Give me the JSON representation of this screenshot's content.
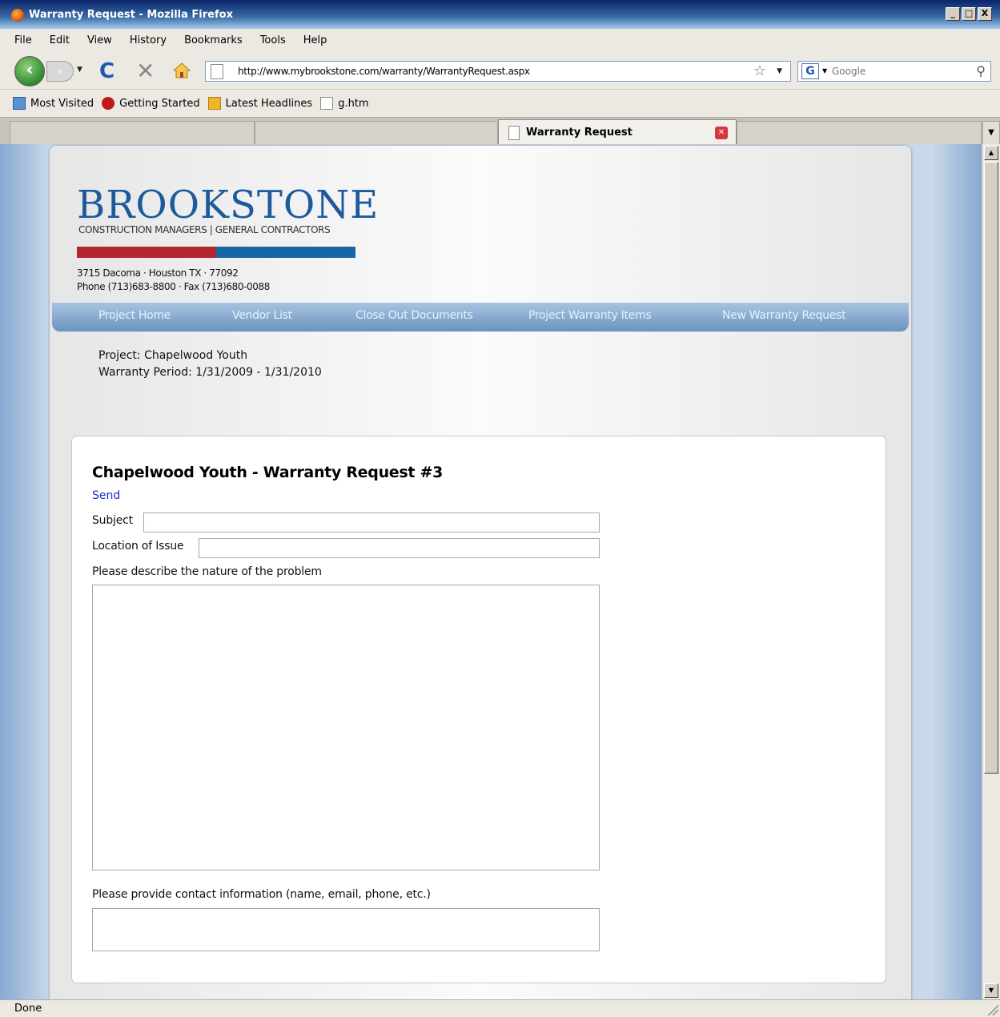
{
  "window": {
    "title": "Warranty Request - Mozilla Firefox",
    "min_label": "_",
    "max_label": "□",
    "close_label": "X"
  },
  "menu": {
    "items": [
      "File",
      "Edit",
      "View",
      "History",
      "Bookmarks",
      "Tools",
      "Help"
    ]
  },
  "nav": {
    "url": "http://www.mybrookstone.com/warranty/WarrantyRequest.aspx",
    "search_placeholder": "Google",
    "search_engine_letter": "G"
  },
  "bookmarks": {
    "items": [
      "Most Visited",
      "Getting Started",
      "Latest Headlines",
      "g.htm"
    ]
  },
  "tabs": {
    "active_label": "Warranty Request"
  },
  "page": {
    "logo_title": "BROOKSTONE",
    "logo_subtitle": "CONSTRUCTION MANAGERS | GENERAL CONTRACTORS",
    "address_line1": "3715 Dacoma · Houston TX · 77092",
    "address_line2": "Phone (713)683-8800 · Fax (713)680-0088",
    "nav_items": [
      "Project Home",
      "Vendor List",
      "Close Out Documents",
      "Project Warranty Items",
      "New Warranty Request"
    ],
    "project_line": "Project: Chapelwood Youth",
    "warranty_period_line": "Warranty Period: 1/31/2009 - 1/31/2010",
    "form": {
      "heading": "Chapelwood Youth - Warranty Request #3",
      "send_label": "Send",
      "subject_label": "Subject",
      "subject_value": "",
      "location_label": "Location of Issue",
      "location_value": "",
      "problem_label": "Please describe the nature of the problem",
      "problem_value": "",
      "contact_label": "Please provide contact information (name, email, phone, etc.)",
      "contact_value": ""
    }
  },
  "status": {
    "text": "Done"
  },
  "colors": {
    "brand_blue": "#1c5a9c",
    "brand_red": "#b3262e",
    "nav_blue": "#6b93c0",
    "link_blue": "#1a2fd1"
  }
}
